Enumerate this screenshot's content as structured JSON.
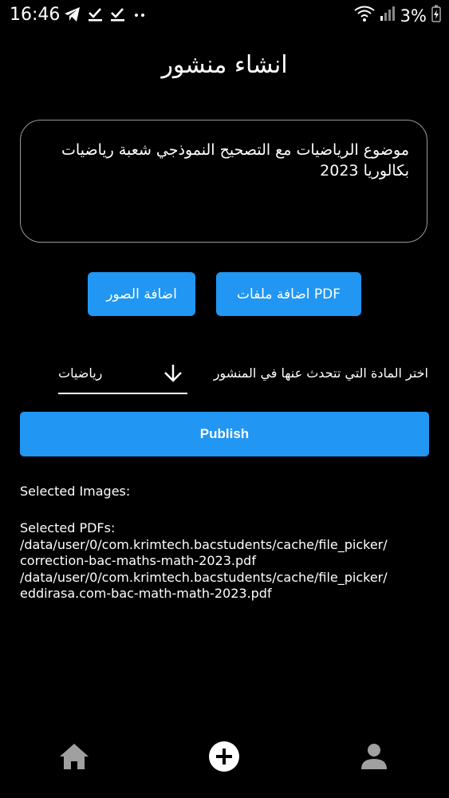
{
  "status_bar": {
    "time": "16:46",
    "battery": "3%",
    "icons_left": [
      "telegram-icon",
      "checkmark-icon",
      "checkmark-icon",
      "dots-icon"
    ],
    "icons_right": [
      "wifi-icon",
      "signal-icon",
      "battery-icon"
    ]
  },
  "header": {
    "title": "انشاء منشور"
  },
  "post": {
    "text": "موضوع الرياضيات مع التصحيح النموذجي شعبة رياضيات بكالوريا 2023"
  },
  "buttons": {
    "add_images": "اضافة الصور",
    "add_pdf": "اضافة ملفات PDF"
  },
  "subject": {
    "label": "اختر المادة التي تتحدث عنها في المنشور",
    "selected": "رياضيات"
  },
  "publish_label": "Publish",
  "selected_images": {
    "label": "Selected Images:"
  },
  "selected_pdfs": {
    "label": "Selected PDFs:",
    "lines": [
      "/data/user/0/com.krimtech.bacstudents/cache/file_picker/",
      "correction-bac-maths-math-2023.pdf",
      "/data/user/0/com.krimtech.bacstudents/cache/file_picker/",
      "eddirasa.com-bac-math-math-2023.pdf"
    ]
  },
  "nav": [
    "home-icon",
    "add-icon",
    "profile-icon"
  ],
  "colors": {
    "accent": "#2196f3",
    "background": "#000000",
    "nav_icon": "#a0a0a0"
  }
}
